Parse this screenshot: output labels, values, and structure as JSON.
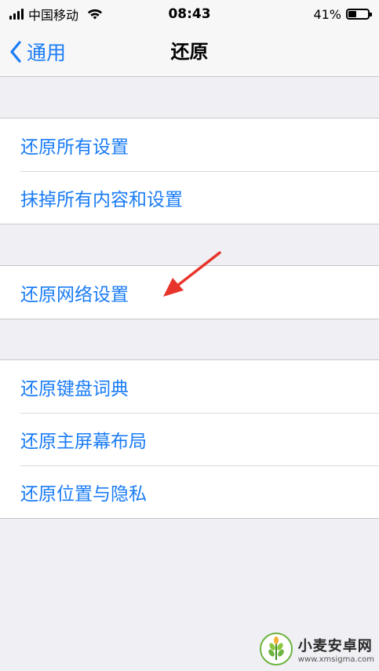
{
  "status_bar": {
    "carrier": "中国移动",
    "time": "08:43",
    "battery_percent_text": "41%",
    "battery_level": 0.41
  },
  "nav": {
    "back_label": "通用",
    "title": "还原"
  },
  "groups": [
    {
      "items": [
        "还原所有设置",
        "抹掉所有内容和设置"
      ]
    },
    {
      "items": [
        "还原网络设置"
      ]
    },
    {
      "items": [
        "还原键盘词典",
        "还原主屏幕布局",
        "还原位置与隐私"
      ]
    }
  ],
  "watermark": {
    "name": "小麦安卓网",
    "url": "www.xmsigma.com"
  },
  "colors": {
    "accent": "#1a7cf5",
    "background": "#efeff4",
    "cell": "#ffffff",
    "separator": "#c8c7cc",
    "annotation_arrow": "#e8352b"
  },
  "icons": {
    "signal": "cellular-signal-icon",
    "wifi": "wifi-icon",
    "battery": "battery-icon",
    "back": "chevron-left-icon",
    "annotation": "red-arrow-icon",
    "watermark_logo": "wheat-logo-icon"
  }
}
